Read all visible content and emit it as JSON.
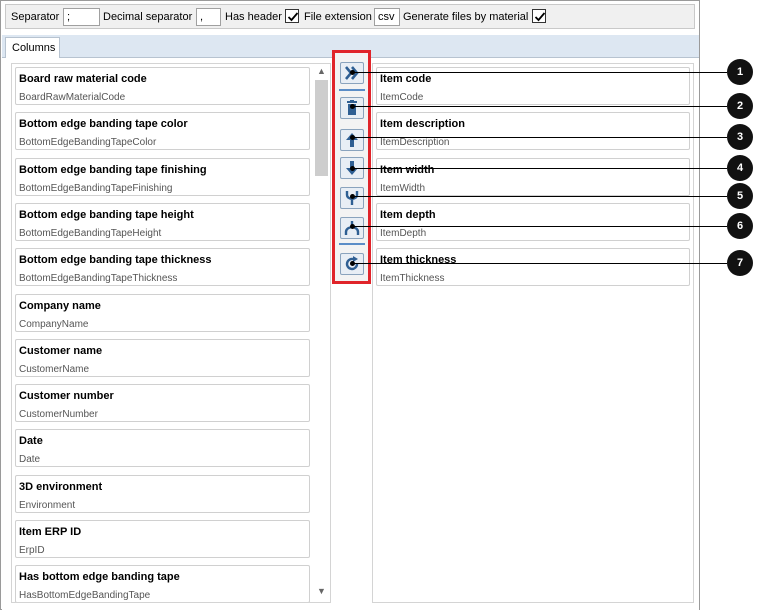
{
  "toolbar": {
    "separator_label": "Separator",
    "separator_value": ";",
    "decimal_label": "Decimal separator",
    "decimal_value": ",",
    "has_header_label": "Has header",
    "has_header_checked": true,
    "file_ext_label": "File extension",
    "file_ext_value": "csv",
    "by_material_label": "Generate files by material",
    "by_material_checked": true
  },
  "tabs": [
    {
      "label": "Columns",
      "active": true
    }
  ],
  "available_columns": [
    {
      "title": "Board raw material code",
      "field": "BoardRawMaterialCode"
    },
    {
      "title": "Bottom edge banding tape color",
      "field": "BottomEdgeBandingTapeColor"
    },
    {
      "title": "Bottom edge banding tape finishing",
      "field": "BottomEdgeBandingTapeFinishing"
    },
    {
      "title": "Bottom edge banding tape height",
      "field": "BottomEdgeBandingTapeHeight"
    },
    {
      "title": "Bottom edge banding tape thickness",
      "field": "BottomEdgeBandingTapeThickness"
    },
    {
      "title": "Company name",
      "field": "CompanyName"
    },
    {
      "title": "Customer name",
      "field": "CustomerName"
    },
    {
      "title": "Customer number",
      "field": "CustomerNumber"
    },
    {
      "title": "Date",
      "field": "Date"
    },
    {
      "title": "3D environment",
      "field": "Environment"
    },
    {
      "title": "Item ERP ID",
      "field": "ErpID"
    },
    {
      "title": "Has bottom edge banding tape",
      "field": "HasBottomEdgeBandingTape"
    }
  ],
  "selected_columns": [
    {
      "title": "Item code",
      "field": "ItemCode"
    },
    {
      "title": "Item description",
      "field": "ItemDescription"
    },
    {
      "title": "Item width",
      "field": "ItemWidth"
    },
    {
      "title": "Item depth",
      "field": "ItemDepth"
    },
    {
      "title": "Item thickness",
      "field": "ItemThickness"
    }
  ],
  "actions": [
    {
      "icon": "double-chevron-right-icon",
      "callout": "1"
    },
    {
      "icon": "trash-icon",
      "callout": "2"
    },
    {
      "icon": "arrow-up-icon",
      "callout": "3"
    },
    {
      "icon": "arrow-down-icon",
      "callout": "4"
    },
    {
      "icon": "merge-icon",
      "callout": "5"
    },
    {
      "icon": "split-icon",
      "callout": "6"
    },
    {
      "icon": "refresh-icon",
      "callout": "7"
    }
  ],
  "colors": {
    "highlight": "#e0242a",
    "icon_blue": "#2f5f93",
    "tab_strip": "#dde7f2"
  }
}
